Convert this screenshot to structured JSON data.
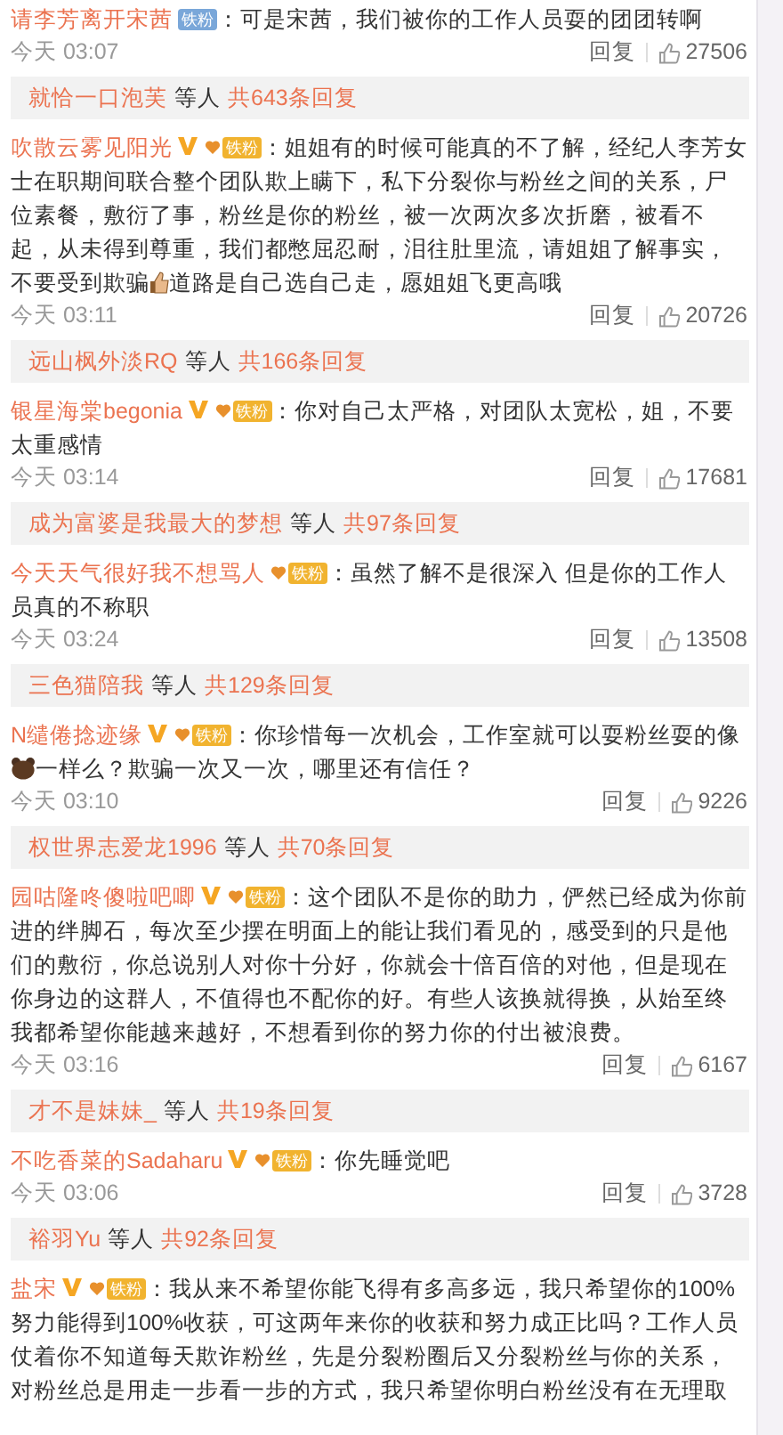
{
  "comments": [
    {
      "user": "请李芳离开宋茜",
      "verified": false,
      "badge": {
        "kind": "blue",
        "label": "铁粉"
      },
      "separator": "：",
      "content": [
        {
          "kind": "text",
          "text": "可是宋茜，我们被你的工作人员耍的团团转啊"
        }
      ],
      "time": "今天 03:07",
      "reply_label": "回复",
      "likes": "27506",
      "replies": {
        "names": "就恰一口泡芙",
        "others": "等人",
        "count": "共643条回复"
      }
    },
    {
      "user": "吹散云雾见阳光",
      "verified": true,
      "badge": {
        "kind": "gold",
        "label": "铁粉"
      },
      "separator": "：",
      "content": [
        {
          "kind": "text",
          "text": "姐姐有的时候可能真的不了解，经纪人李芳女士在职期间联合整个团队欺上瞒下，私下分裂你与粉丝之间的关系，尸位素餐，敷衍了事，粉丝是你的粉丝，被一次两次多次折磨，被看不起，从未得到尊重，我们都憋屈忍耐，泪往肚里流，请姐姐了解事实，不要受到欺骗"
        },
        {
          "kind": "thumb"
        },
        {
          "kind": "text",
          "text": "道路是自己选自己走，愿姐姐飞更高哦"
        }
      ],
      "time": "今天 03:11",
      "reply_label": "回复",
      "likes": "20726",
      "replies": {
        "names": "远山枫外淡RQ",
        "others": "等人",
        "count": "共166条回复"
      }
    },
    {
      "user": "银星海棠begonia",
      "verified": true,
      "badge": {
        "kind": "gold",
        "label": "铁粉"
      },
      "separator": "：",
      "content": [
        {
          "kind": "text",
          "text": "你对自己太严格，对团队太宽松，姐，不要太重感情"
        }
      ],
      "time": "今天 03:14",
      "reply_label": "回复",
      "likes": "17681",
      "replies": {
        "names": "成为富婆是我最大的梦想",
        "others": "等人",
        "count": "共97条回复"
      }
    },
    {
      "user": "今天天气很好我不想骂人",
      "verified": false,
      "badge": {
        "kind": "gold",
        "label": "铁粉"
      },
      "separator": "：",
      "content": [
        {
          "kind": "text",
          "text": "虽然了解不是很深入 但是你的工作人员真的不称职"
        }
      ],
      "time": "今天 03:24",
      "reply_label": "回复",
      "likes": "13508",
      "replies": {
        "names": "三色猫陪我",
        "others": "等人",
        "count": "共129条回复"
      }
    },
    {
      "user": "N缱倦捻迹缘",
      "verified": true,
      "badge": {
        "kind": "gold",
        "label": "铁粉"
      },
      "separator": "：",
      "content": [
        {
          "kind": "text",
          "text": "你珍惜每一次机会，工作室就可以耍粉丝耍的像"
        },
        {
          "kind": "bear"
        },
        {
          "kind": "text",
          "text": "一样么？欺骗一次又一次，哪里还有信任？"
        }
      ],
      "time": "今天 03:10",
      "reply_label": "回复",
      "likes": "9226",
      "replies": {
        "names": "权世界志爱龙1996",
        "others": "等人",
        "count": "共70条回复"
      }
    },
    {
      "user": "园咕隆咚傻啦吧唧",
      "verified": true,
      "badge": {
        "kind": "gold",
        "label": "铁粉"
      },
      "separator": "：",
      "content": [
        {
          "kind": "text",
          "text": "这个团队不是你的助力，俨然已经成为你前进的绊脚石，每次至少摆在明面上的能让我们看见的，感受到的只是他们的敷衍，你总说别人对你十分好，你就会十倍百倍的对他，但是现在你身边的这群人，不值得也不配你的好。有些人该换就得换，从始至终我都希望你能越来越好，不想看到你的努力你的付出被浪费。"
        }
      ],
      "time": "今天 03:16",
      "reply_label": "回复",
      "likes": "6167",
      "replies": {
        "names": "才不是妹妹_",
        "others": "等人",
        "count": "共19条回复"
      }
    },
    {
      "user": "不吃香菜的Sadaharu",
      "verified": true,
      "badge": {
        "kind": "gold",
        "label": "铁粉"
      },
      "separator": "：",
      "content": [
        {
          "kind": "text",
          "text": "你先睡觉吧"
        }
      ],
      "time": "今天 03:06",
      "reply_label": "回复",
      "likes": "3728",
      "replies": {
        "names": "裕羽Yu",
        "others": "等人",
        "count": "共92条回复"
      }
    },
    {
      "user": "盐宋",
      "verified": true,
      "badge": {
        "kind": "gold",
        "label": "铁粉"
      },
      "separator": "：",
      "content": [
        {
          "kind": "text",
          "text": "我从来不希望你能飞得有多高多远，我只希望你的100%努力能得到100%收获，可这两年来你的收获和努力成正比吗？工作人员仗着你不知道每天欺诈粉丝，先是分裂粉圈后又分裂粉丝与你的关系，对粉丝总是用走一步看一步的方式，我只希望你明白粉丝没有在无理取"
        }
      ]
    }
  ]
}
